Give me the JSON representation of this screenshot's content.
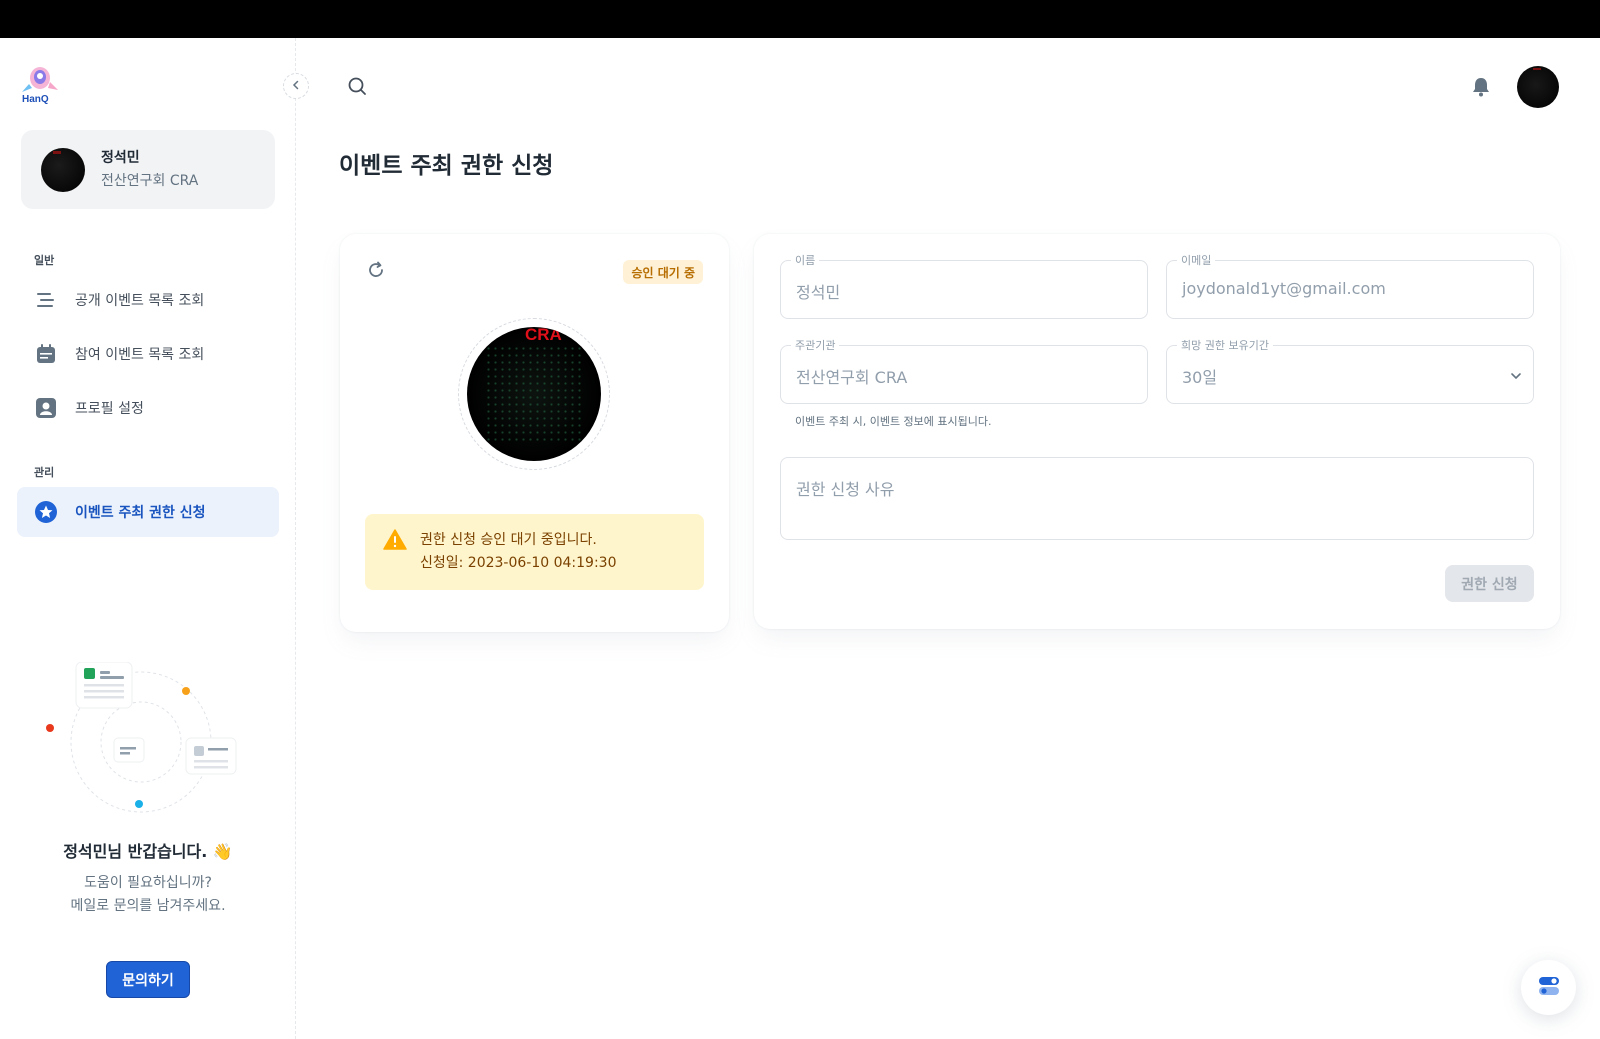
{
  "app": {
    "logo_text": "HanQ"
  },
  "account": {
    "name": "정석민",
    "org": "전산연구회 CRA"
  },
  "nav": {
    "section_general": "일반",
    "section_manage": "관리",
    "items": [
      {
        "label": "공개 이벤트 목록 조회",
        "icon": "list-icon"
      },
      {
        "label": "참여 이벤트 목록 조회",
        "icon": "calendar-icon"
      },
      {
        "label": "프로필 설정",
        "icon": "user-icon"
      },
      {
        "label": "이벤트 주최 권한 신청",
        "icon": "star-icon",
        "active": true
      }
    ]
  },
  "welcome": {
    "title": "정석민님 반갑습니다. 👋",
    "line1": "도움이 필요하십니까?",
    "line2": "메일로 문의를 남겨주세요.",
    "contact_label": "문의하기"
  },
  "page": {
    "title": "이벤트 주최 권한 신청"
  },
  "status": {
    "badge": "승인 대기 중",
    "avatar_text": "CRA",
    "alert_line1": "권한 신청 승인 대기 중입니다.",
    "alert_line2": "신청일: 2023-06-10 04:19:30"
  },
  "form": {
    "name_label": "이름",
    "name_value": "정석민",
    "email_label": "이메일",
    "email_value": "joydonald1yt@gmail.com",
    "org_label": "주관기관",
    "org_value": "전산연구회 CRA",
    "period_label": "희망 권한 보유기간",
    "period_value": "30일",
    "org_helper": "이벤트 주최 시, 이벤트 정보에 표시됩니다.",
    "reason_placeholder": "권한 신청 사유",
    "submit_label": "권한 신청"
  },
  "colors": {
    "accent": "#1f63d6",
    "active_bg": "#ebf2fc",
    "warning_bg": "#fff5cc",
    "badge_bg": "#fff1d6"
  }
}
